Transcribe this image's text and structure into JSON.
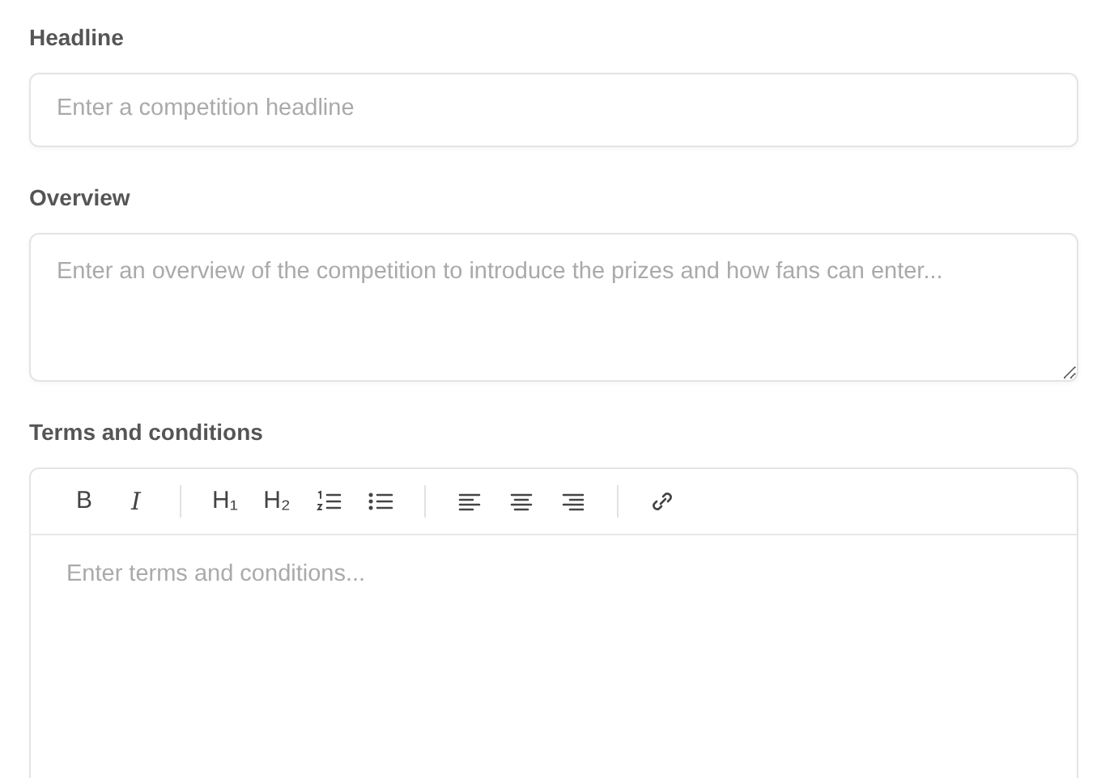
{
  "fields": [
    {
      "label": "Headline",
      "kind": "input",
      "placeholder": "Enter a competition headline"
    },
    {
      "label": "Overview",
      "kind": "textarea",
      "placeholder": "Enter an overview of the competition to introduce the prizes and how fans can enter..."
    },
    {
      "label": "Terms and conditions",
      "kind": "editor",
      "placeholder": "Enter terms and conditions...",
      "toolbar_text": [
        "B",
        "I",
        "H₁",
        "H₂"
      ]
    }
  ]
}
